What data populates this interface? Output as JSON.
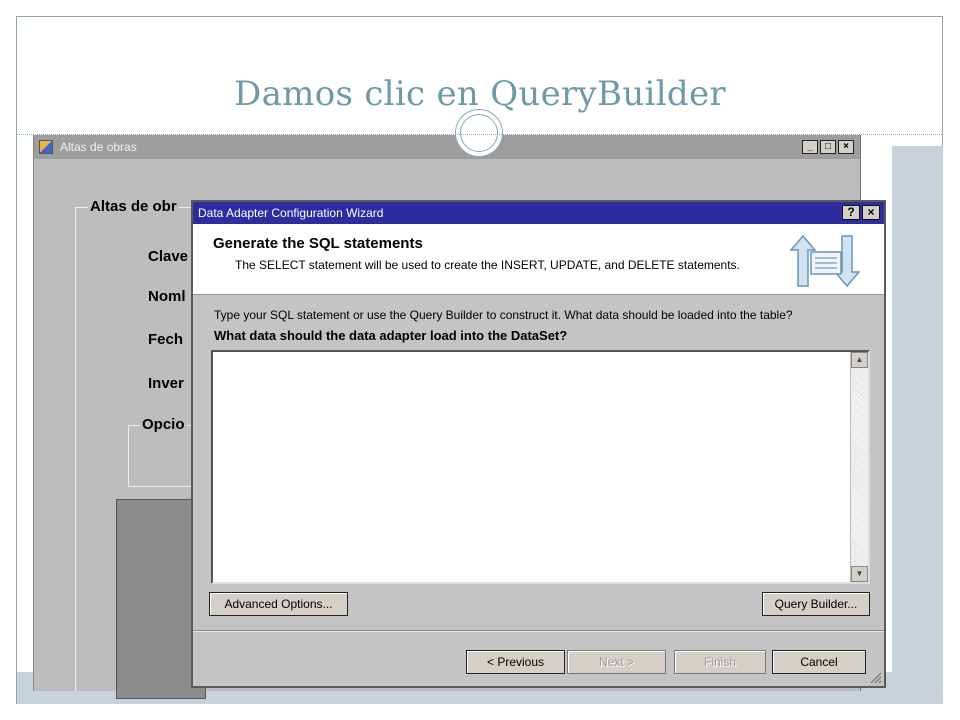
{
  "slide": {
    "title": "Damos clic en QueryBuilder"
  },
  "background_window": {
    "title": "Altas de obras",
    "controls": [
      "_",
      "□",
      "×"
    ],
    "group_label": "Altas de obr",
    "fields": [
      "Clave",
      "Noml",
      "Fech",
      "Inver"
    ],
    "options_label": "Opcio"
  },
  "dialog": {
    "title": "Data Adapter Configuration Wizard",
    "controls": [
      "?",
      "×"
    ],
    "heading": "Generate the SQL statements",
    "subheading": "The SELECT statement will be used to create the INSERT, UPDATE, and DELETE statements.",
    "instructions": "Type your SQL statement or use the Query Builder to construct it. What data should be loaded into the table?",
    "question": "What data should the data adapter load into the DataSet?",
    "sql_text": "",
    "buttons": {
      "advanced": "Advanced Options...",
      "query_builder": "Query Builder...",
      "previous": "< Previous",
      "next": "Next >",
      "finish": "Finish",
      "cancel": "Cancel"
    }
  },
  "colors": {
    "title": "#6d9aa6",
    "dialog_titlebar": "#2d2da0",
    "accent_panel": "#c7d3d8"
  }
}
